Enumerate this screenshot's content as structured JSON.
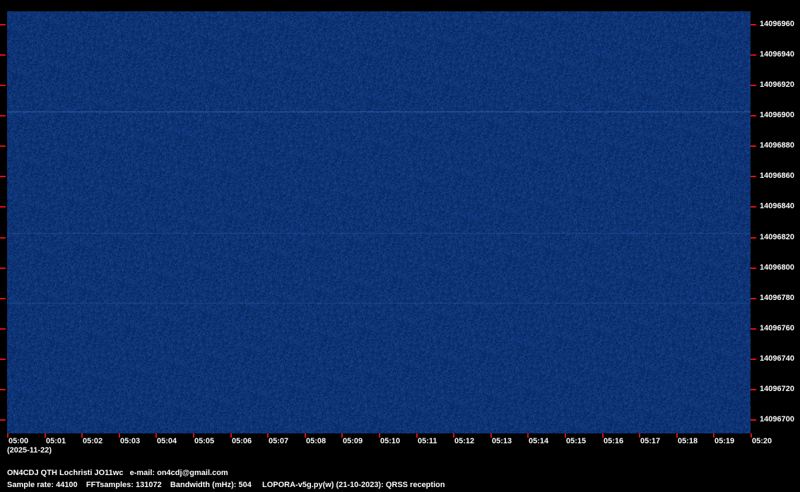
{
  "chart_data": {
    "type": "heatmap",
    "title": "QRSS waterfall",
    "date": "(2025-11-22)",
    "x_ticks": [
      "05:00",
      "05:01",
      "05:02",
      "05:03",
      "05:04",
      "05:05",
      "05:06",
      "05:07",
      "05:08",
      "05:09",
      "05:10",
      "05:11",
      "05:12",
      "05:13",
      "05:14",
      "05:15",
      "05:16",
      "05:17",
      "05:18",
      "05:19",
      "05:20"
    ],
    "y_ticks": [
      "14096960",
      "14096940",
      "14096920",
      "14096900",
      "14096880",
      "14096860",
      "14096840",
      "14096820",
      "14096800",
      "14096780",
      "14096760",
      "14096740",
      "14096720",
      "14096700"
    ],
    "xlim": [
      "05:00",
      "05:20"
    ],
    "ylim": [
      14096691,
      14096969
    ],
    "traces_hz": [
      14096903,
      14096823,
      14096777
    ],
    "colors": {
      "background": "#0f3778",
      "tick": "#e01010",
      "trace": "#3f74c0"
    }
  },
  "footer": {
    "station": "ON4CDJ QTH Lochristi JO11wc   e-mail: on4cdj@gmail.com",
    "params": "Sample rate: 44100    FFTsamples: 131072    Bandwidth (mHz): 504",
    "software": "LOPORA-v5g.py(w) (21-10-2023): QRSS reception"
  }
}
